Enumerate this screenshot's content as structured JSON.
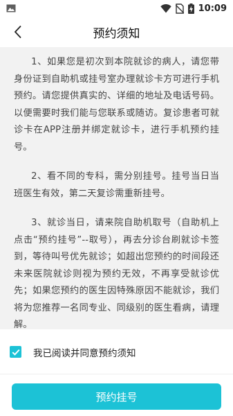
{
  "status_bar": {
    "time": "10:09",
    "icons": [
      "image-notification-icon",
      "wifi-icon",
      "no-sim-icon",
      "battery-charging-icon"
    ]
  },
  "header": {
    "title": "预约须知",
    "back_icon": "chevron-left-icon"
  },
  "notice": {
    "paragraphs": [
      "1、如果您是初次到本院就诊的病人，请您带身份证到自助机或挂号室办理就诊卡方可进行手机预约。请您提供真实的、详细的地址及电话号码。以便需要时我们能与您联系或随访。复诊患者可就诊卡在APP注册并绑定就诊卡，进行手机预约挂号。",
      "2、看不同的专科，需分别挂号。挂号当日当班医生有效，第二天复诊需重新挂号。",
      "3、就诊当日，请来院自助机取号（自助机上点击“预约挂号”--取号），再去分诊台刷就诊卡签到，等待叫号优先就诊；如超出您预约的时间段还未来医院就诊则视为预约无效，不再享受就诊优先；如果您预约的医生因特殊原因不能就诊，我们将为您推荐一名同专业、同级别的医生看病，请理解。"
    ]
  },
  "agreement": {
    "checked": true,
    "label": "我已阅读并同意预约须知"
  },
  "actions": {
    "submit_label": "预约挂号"
  },
  "colors": {
    "accent": "#1cc2d6",
    "content_bg": "#f2f2f2",
    "text": "#444444"
  }
}
